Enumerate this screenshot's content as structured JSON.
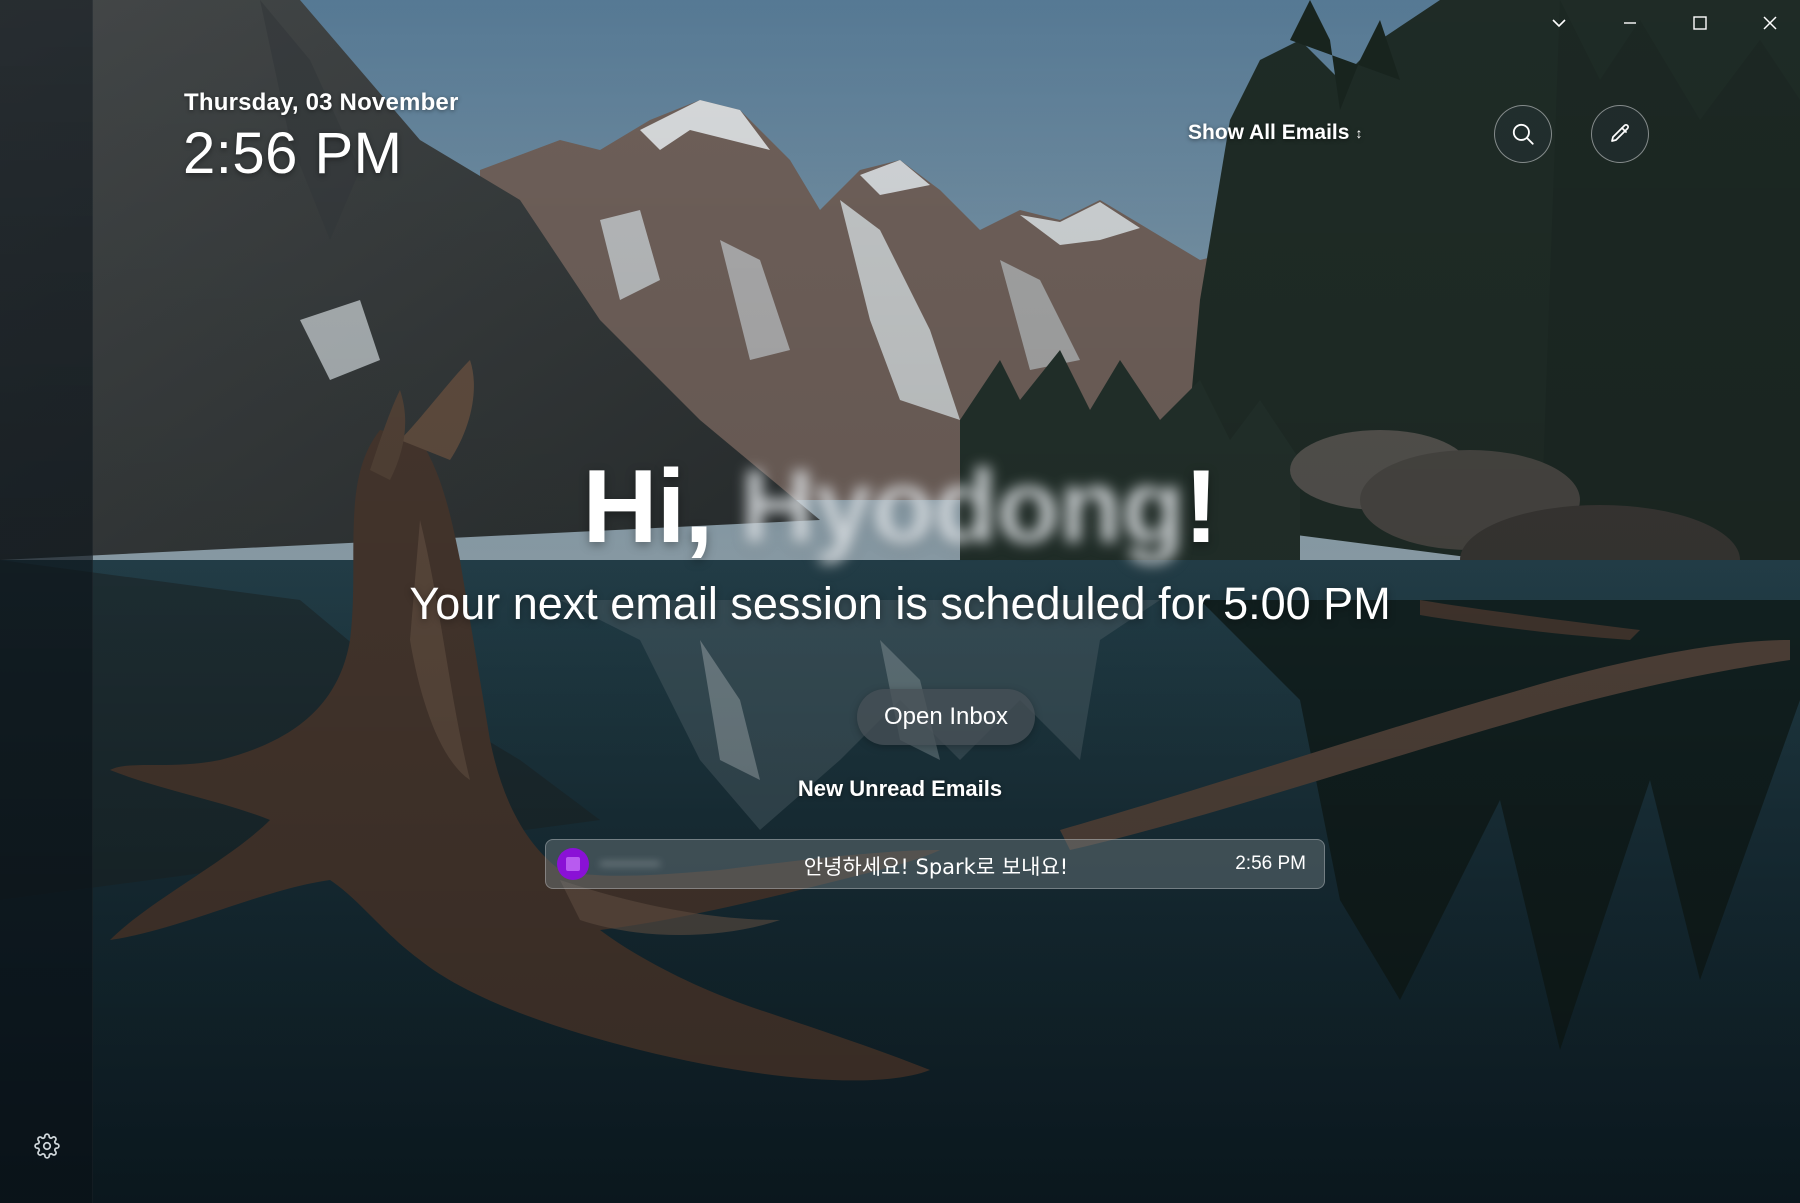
{
  "header": {
    "date": "Thursday, 03 November",
    "time": "2:56 PM",
    "show_all_label": "Show All Emails",
    "show_all_caret": "↕"
  },
  "window_controls": {
    "dropdown": "chevron-down-icon",
    "minimize": "minimize-icon",
    "maximize": "maximize-icon",
    "close": "close-icon"
  },
  "icons": {
    "search": "search-icon",
    "compose": "pencil-icon",
    "settings": "gear-icon"
  },
  "greeting": {
    "prefix": "Hi, ",
    "name": "Hyodong",
    "suffix": "!"
  },
  "session": {
    "text": "Your next email session is scheduled for 5:00 PM"
  },
  "actions": {
    "open_inbox_label": "Open Inbox"
  },
  "unread": {
    "title": "New Unread Emails",
    "emails": [
      {
        "sender": "———",
        "subject": "안녕하세요! Spark로 보내요!",
        "time": "2:56 PM",
        "avatar_color": "#8a11d6"
      }
    ]
  },
  "colors": {
    "accent": "#8a11d6",
    "text": "#ffffff"
  }
}
